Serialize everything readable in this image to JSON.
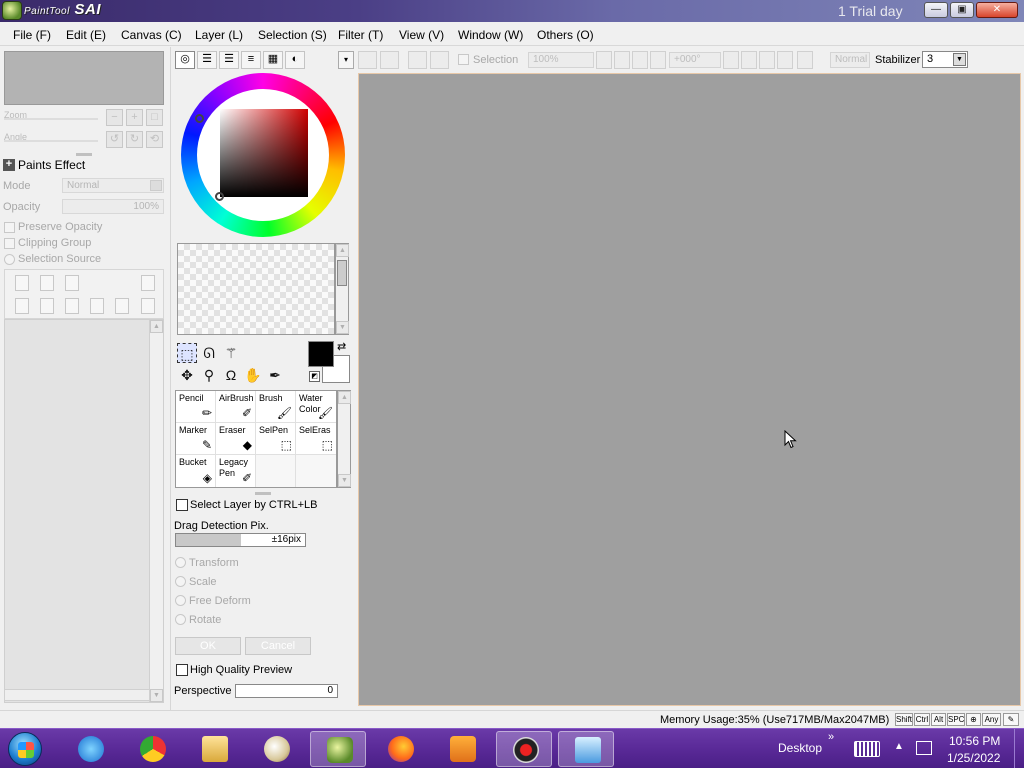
{
  "window": {
    "logo_text": "PaintTool",
    "app_name": "SAI",
    "trial_text": "1 Trial day",
    "buttons": {
      "minimize": "—",
      "restore": "▣",
      "close": "✕"
    }
  },
  "menu": [
    "File (F)",
    "Edit (E)",
    "Canvas (C)",
    "Layer (L)",
    "Selection (S)",
    "Filter (T)",
    "View (V)",
    "Window (W)",
    "Others (O)"
  ],
  "left_panel": {
    "navigator_zoom_label": "Zoom",
    "navigator_angle_label": "Angle",
    "paints_effect": "Paints Effect",
    "mode_label": "Mode",
    "mode_value": "Normal",
    "opacity_label": "Opacity",
    "opacity_value": "100%",
    "preserve_opacity": "Preserve Opacity",
    "clipping_group": "Clipping Group",
    "selection_source": "Selection Source"
  },
  "tools_panel": {
    "brushes": [
      {
        "name": "Pencil",
        "icon": "pencil-icon"
      },
      {
        "name": "AirBrush",
        "icon": "airbrush-icon"
      },
      {
        "name": "Brush",
        "icon": "brush-icon"
      },
      {
        "name": "Water Color",
        "icon": "watercolor-icon"
      },
      {
        "name": "Marker",
        "icon": "marker-icon"
      },
      {
        "name": "Eraser",
        "icon": "eraser-icon"
      },
      {
        "name": "SelPen",
        "icon": "selpen-icon"
      },
      {
        "name": "SelEras",
        "icon": "seleras-icon"
      },
      {
        "name": "Bucket",
        "icon": "bucket-icon"
      },
      {
        "name": "Legacy Pen",
        "icon": "legacy-pen-icon"
      }
    ],
    "select_layer_ctrl": "Select Layer by CTRL+LB",
    "drag_detection_label": "Drag Detection Pix.",
    "drag_detection_value": "±16pix",
    "drag_detection_level": 0.5,
    "transform": "Transform",
    "scale": "Scale",
    "free_deform": "Free Deform",
    "rotate": "Rotate",
    "ok_button": "OK",
    "cancel_button": "Cancel",
    "high_quality_preview": "High Quality Preview",
    "perspective_label": "Perspective",
    "perspective_value": "0",
    "foreground_color": "#000000",
    "background_color": "#ffffff"
  },
  "top_toolbar": {
    "selection_label": "Selection",
    "zoom_value": "100%",
    "angle_value": "+000°",
    "blend_mode": "Normal",
    "stabilizer_label": "Stabilizer",
    "stabilizer_value": "3"
  },
  "status_bar": {
    "memory_usage": "Memory Usage:35% (Use717MB/Max2047MB)",
    "keys": [
      "Shift",
      "Ctrl",
      "Alt",
      "SPC",
      "⊕",
      "Any",
      "✎"
    ]
  },
  "taskbar": {
    "desktop_label": "Desktop",
    "chevron": "»",
    "time": "10:56 PM",
    "date": "1/25/2022"
  },
  "colors": {
    "canvas": "#9f9f9f",
    "taskbar": "#5a2a98",
    "panel": "#f0f0f0"
  }
}
